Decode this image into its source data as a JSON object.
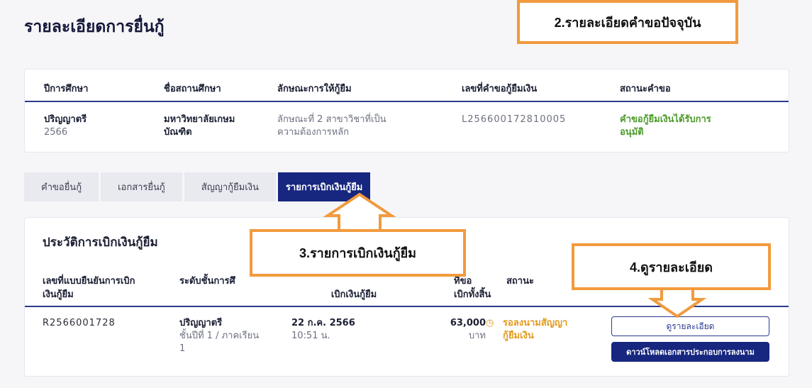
{
  "page": {
    "title": "รายละเอียดการยื่นกู้"
  },
  "summary": {
    "headers": [
      "ปีการศึกษา",
      "ชื่อสถานศึกษา",
      "ลักษณะการให้กู้ยืม",
      "เลขที่คำขอกู้ยืมเงิน",
      "สถานะคำขอ"
    ],
    "level": "ปริญญาตรี",
    "year": "2566",
    "school": "มหาวิทยาลัยเกษม\nบัณฑิต",
    "loan_type": "ลักษณะที่ 2 สาขาวิชาที่เป็น\nความต้องการหลัก",
    "request_no": "L256600172810005",
    "status": "คำขอกู้ยืมเงินได้รับการ\nอนุมัติ"
  },
  "tabs": [
    {
      "label": "คำขอยื่นกู้"
    },
    {
      "label": "เอกสารยื่นกู้"
    },
    {
      "label": "สัญญากู้ยืมเงิน"
    },
    {
      "label": "รายการเบิกเงินกู้ยืม"
    }
  ],
  "history": {
    "title": "ประวัติการเบิกเงินกู้ยืม",
    "headers": [
      "เลขที่แบบยืนยันการเบิก\nเงินกู้ยืม",
      "ระดับชั้นการศึ",
      "เบิกเงินกู้ยืม",
      "ที่ขอ\nเบิกทั้งสิ้น",
      "สถานะ"
    ],
    "row": {
      "confirm_no": "R2566001728",
      "level": "ปริญญาตรี",
      "level_detail": "ชั้นปีที่ 1 / ภาคเรียน\n1",
      "date": "22 ก.ค. 2566",
      "time": "10:51 น.",
      "amount": "63,000",
      "currency": "บาท",
      "status": "รอลงนามสัญญา\nกู้ยืมเงิน"
    },
    "view_button": "ดูรายละเอียด",
    "download_button": "ดาวน์โหลดเอกสารประกอบการลงนาม"
  },
  "callouts": {
    "c2": "2.รายละเอียดคำขอปัจจุบัน",
    "c3": "3.รายการเบิกเงินกู้ยืม",
    "c4": "4.ดูรายละเอียด"
  },
  "icons": {
    "status": "clock-icon"
  },
  "colors": {
    "primary": "#17267f",
    "callout_border": "#f29a3d",
    "approved": "#4c9a2a",
    "pending": "#e39a1c"
  }
}
